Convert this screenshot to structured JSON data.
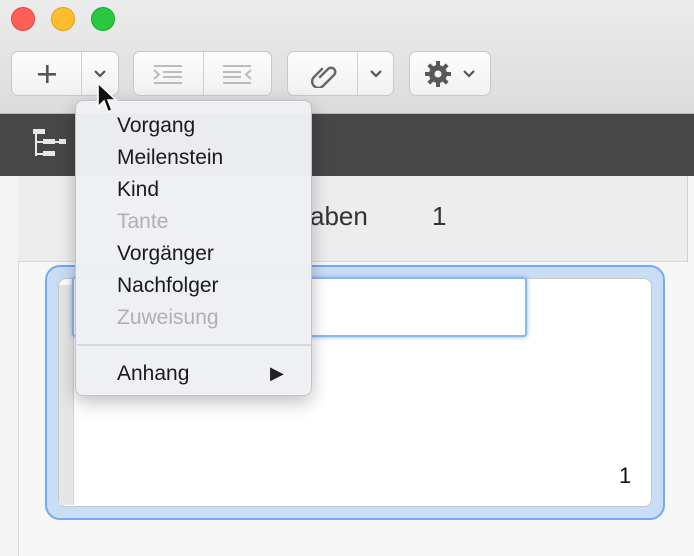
{
  "window": {
    "traffic_lights": {
      "close": "#fe5f57",
      "minimize": "#febc2e",
      "zoom": "#28c840"
    }
  },
  "toolbar": {
    "add_icon": "plus-icon",
    "add_menu_icon": "chevron-down-icon",
    "indent_icon": "indent-icon",
    "outdent_icon": "outdent-icon",
    "link_icon": "paperclip-icon",
    "link_menu_icon": "chevron-down-icon",
    "settings_icon": "gear-icon"
  },
  "sidebar": {
    "view_icon": "tree-view-icon"
  },
  "header": {
    "col_a": "aben",
    "col_b": "1"
  },
  "card": {
    "number": "1",
    "accent": "#74aaf0"
  },
  "menu": {
    "items": [
      {
        "label": "Vorgang",
        "enabled": true
      },
      {
        "label": "Meilenstein",
        "enabled": true
      },
      {
        "label": "Kind",
        "enabled": true
      },
      {
        "label": "Tante",
        "enabled": false
      },
      {
        "label": "Vorgänger",
        "enabled": true
      },
      {
        "label": "Nachfolger",
        "enabled": true
      },
      {
        "label": "Zuweisung",
        "enabled": false
      }
    ],
    "submenu": {
      "label": "Anhang",
      "arrow": "▶"
    }
  }
}
